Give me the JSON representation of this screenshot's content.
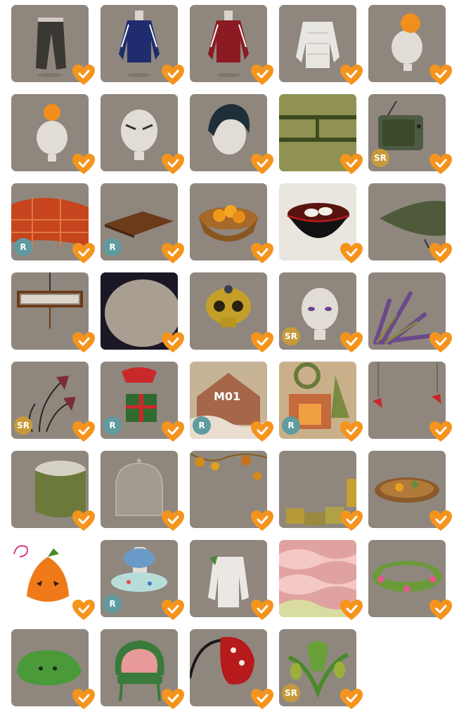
{
  "colors": {
    "tile": "#8f877e",
    "heart": "#f5941c",
    "rarity_r": "#5f9b9f",
    "rarity_sr": "#c89a3a"
  },
  "grid": {
    "items": [
      {
        "icon": "trousers-icon",
        "rarity": ""
      },
      {
        "icon": "blue-track-jacket-icon",
        "rarity": ""
      },
      {
        "icon": "red-track-jacket-icon",
        "rarity": ""
      },
      {
        "icon": "white-puffer-jacket-icon",
        "rarity": ""
      },
      {
        "icon": "orange-hat-icon",
        "rarity": ""
      },
      {
        "icon": "orange-head-accessory-icon",
        "rarity": ""
      },
      {
        "icon": "angry-face-icon",
        "rarity": ""
      },
      {
        "icon": "dark-hair-icon",
        "rarity": ""
      },
      {
        "icon": "tatami-floor-icon",
        "rarity": ""
      },
      {
        "icon": "retro-tv-icon",
        "rarity": "SR"
      },
      {
        "icon": "plaid-kotatsu-futon-icon",
        "rarity": "R"
      },
      {
        "icon": "wooden-board-icon",
        "rarity": "R"
      },
      {
        "icon": "basket-of-oranges-icon",
        "rarity": ""
      },
      {
        "icon": "zenzai-bowl-icon",
        "rarity": ""
      },
      {
        "icon": "green-cushion-icon",
        "rarity": ""
      },
      {
        "icon": "ceiling-lamp-icon",
        "rarity": ""
      },
      {
        "icon": "dark-vignette-frame-icon",
        "rarity": ""
      },
      {
        "icon": "golden-skull-icon",
        "rarity": ""
      },
      {
        "icon": "purple-eyes-face-icon",
        "rarity": "SR"
      },
      {
        "icon": "lavender-plant-icon",
        "rarity": ""
      },
      {
        "icon": "withered-flowers-icon",
        "rarity": "SR"
      },
      {
        "icon": "gift-box-costume-icon",
        "rarity": "R"
      },
      {
        "icon": "gingerbread-house-background-icon",
        "rarity": "R",
        "label": "M01"
      },
      {
        "icon": "christmas-fireplace-background-icon",
        "rarity": "R"
      },
      {
        "icon": "hanging-ornaments-icon",
        "rarity": ""
      },
      {
        "icon": "cake-box-icon",
        "rarity": ""
      },
      {
        "icon": "glass-dome-icon",
        "rarity": ""
      },
      {
        "icon": "autumn-leaves-icon",
        "rarity": ""
      },
      {
        "icon": "gift-pile-icon",
        "rarity": ""
      },
      {
        "icon": "stew-plate-icon",
        "rarity": ""
      },
      {
        "icon": "pumpkin-hat-icon",
        "rarity": ""
      },
      {
        "icon": "ufo-float-ring-icon",
        "rarity": "R"
      },
      {
        "icon": "white-sweater-icon",
        "rarity": ""
      },
      {
        "icon": "wavy-pattern-background-icon",
        "rarity": ""
      },
      {
        "icon": "polka-dot-ring-icon",
        "rarity": ""
      },
      {
        "icon": "green-slime-creature-icon",
        "rarity": ""
      },
      {
        "icon": "shell-chair-icon",
        "rarity": ""
      },
      {
        "icon": "mushroom-lamp-icon",
        "rarity": ""
      },
      {
        "icon": "pitcher-plant-icon",
        "rarity": "SR"
      },
      {
        "icon": "empty-slot",
        "rarity": ""
      }
    ]
  }
}
